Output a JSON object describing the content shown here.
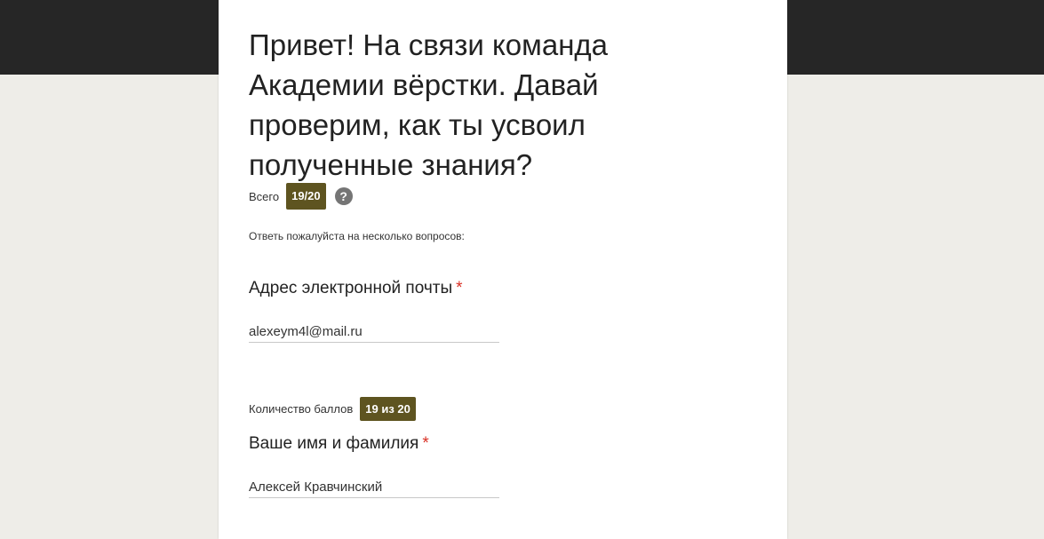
{
  "form": {
    "title": "Привет! На связи команда Академии вёрстки. Давай проверим, как ты усвоил полученные знания?",
    "total_label": "Всего",
    "total_score": "19/20",
    "help_icon": "?",
    "intro": "Ответь пожалуйста на несколько вопросов:"
  },
  "questions": [
    {
      "label": "Адрес электронной почты",
      "required": "*",
      "answer": "alexeym4l@mail.ru"
    },
    {
      "score_label": "Количество баллов",
      "score": "19 из 20",
      "label": "Ваше имя и фамилия",
      "required": "*",
      "answer": "Алексей Кравчинский"
    }
  ],
  "colors": {
    "header_band": "#262626",
    "page_background": "#eeede8",
    "badge": "#5e5420",
    "required": "#d93025"
  }
}
